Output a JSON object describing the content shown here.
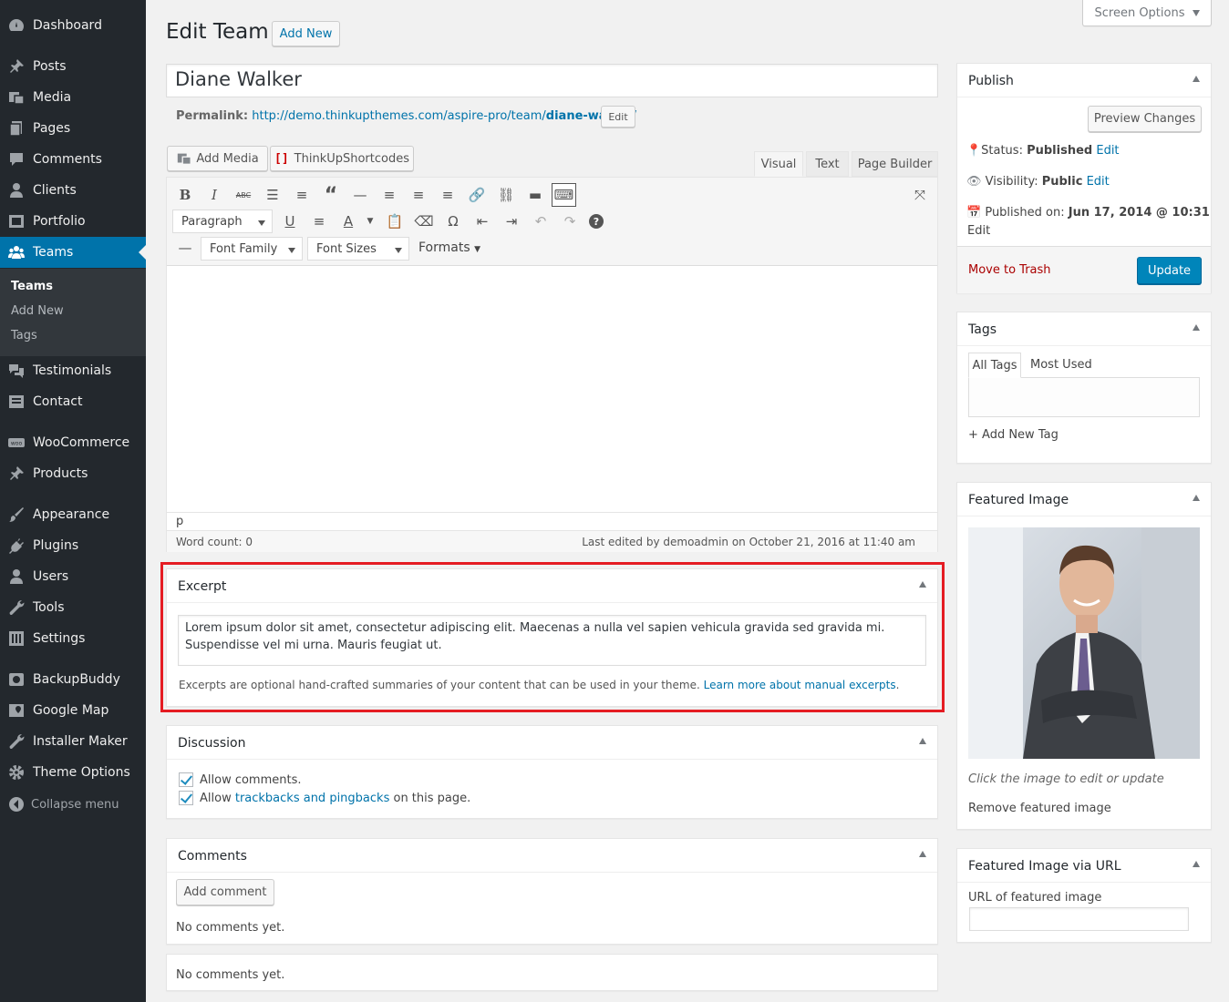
{
  "sidebar": {
    "items": [
      {
        "key": "dashboard",
        "label": "Dashboard",
        "icon": "dashboard-icon"
      },
      {
        "key": "posts",
        "label": "Posts",
        "icon": "pushpin-icon"
      },
      {
        "key": "media",
        "label": "Media",
        "icon": "media-icon"
      },
      {
        "key": "pages",
        "label": "Pages",
        "icon": "pages-icon"
      },
      {
        "key": "comments",
        "label": "Comments",
        "icon": "comment-icon"
      },
      {
        "key": "clients",
        "label": "Clients",
        "icon": "user-icon"
      },
      {
        "key": "portfolio",
        "label": "Portfolio",
        "icon": "portfolio-icon"
      },
      {
        "key": "teams",
        "label": "Teams",
        "icon": "groups-icon"
      },
      {
        "key": "testimonials",
        "label": "Testimonials",
        "icon": "testimonial-icon"
      },
      {
        "key": "contact",
        "label": "Contact",
        "icon": "contact-icon"
      },
      {
        "key": "woocommerce",
        "label": "WooCommerce",
        "icon": "woo-icon"
      },
      {
        "key": "products",
        "label": "Products",
        "icon": "pushpin-icon"
      },
      {
        "key": "appearance",
        "label": "Appearance",
        "icon": "brush-icon"
      },
      {
        "key": "plugins",
        "label": "Plugins",
        "icon": "plug-icon"
      },
      {
        "key": "users",
        "label": "Users",
        "icon": "user-icon"
      },
      {
        "key": "tools",
        "label": "Tools",
        "icon": "wrench-icon"
      },
      {
        "key": "settings",
        "label": "Settings",
        "icon": "settings-icon"
      },
      {
        "key": "backupbuddy",
        "label": "BackupBuddy",
        "icon": "backup-icon"
      },
      {
        "key": "googlemap",
        "label": "Google Map",
        "icon": "map-icon"
      },
      {
        "key": "installer",
        "label": "Installer Maker",
        "icon": "wrench-icon"
      },
      {
        "key": "themeoptions",
        "label": "Theme Options",
        "icon": "gear-icon"
      }
    ],
    "submenu": [
      "Teams",
      "Add New",
      "Tags"
    ],
    "collapse": "Collapse menu"
  },
  "header": {
    "title": "Edit Team",
    "add_new": "Add New",
    "screen_options": "Screen Options"
  },
  "post": {
    "title": "Diane Walker",
    "permalink_label": "Permalink:",
    "permalink_base": "http://demo.thinkupthemes.com/aspire-pro/team/",
    "permalink_slug": "diane-walker",
    "permalink_end": "/",
    "edit": "Edit"
  },
  "editor": {
    "add_media": "Add Media",
    "shortcodes": "ThinkUpShortcodes",
    "tabs": [
      "Visual",
      "Text",
      "Page Builder"
    ],
    "paragraph": "Paragraph",
    "font_family": "Font Family",
    "font_sizes": "Font Sizes",
    "formats": "Formats",
    "path": "p",
    "word_count": "Word count: 0",
    "last_edited": "Last edited by demoadmin on October 21, 2016 at 11:40 am"
  },
  "excerpt": {
    "title": "Excerpt",
    "text": "Lorem ipsum dolor sit amet, consectetur adipiscing elit. Maecenas a nulla vel sapien vehicula gravida sed gravida mi. Suspendisse vel mi urna. Mauris feugiat ut.",
    "help": "Excerpts are optional hand-crafted summaries of your content that can be used in your theme.",
    "help_link": "Learn more about manual excerpts",
    "help_end": "."
  },
  "discussion": {
    "title": "Discussion",
    "allow_comments": "Allow comments.",
    "allow_prefix": "Allow",
    "allow_link": "trackbacks and pingbacks",
    "allow_suffix": "on this page."
  },
  "comments": {
    "title": "Comments",
    "add": "Add comment",
    "none": "No comments yet."
  },
  "extra": {
    "none": "No comments yet."
  },
  "publish": {
    "title": "Publish",
    "preview": "Preview Changes",
    "status_label": "Status:",
    "status": "Published",
    "visibility_label": "Visibility:",
    "visibility": "Public",
    "published_on_label": "Published on:",
    "published_on": "Jun 17, 2014 @ 10:31",
    "edit": "Edit",
    "trash": "Move to Trash",
    "update": "Update"
  },
  "tags": {
    "title": "Tags",
    "tab_all": "All Tags",
    "tab_most": "Most Used",
    "add": "+ Add New Tag"
  },
  "featured": {
    "title": "Featured Image",
    "caption": "Click the image to edit or update",
    "remove": "Remove featured image"
  },
  "featured_url": {
    "title": "Featured Image via URL",
    "label": "URL of featured image",
    "value": ""
  },
  "colors": {
    "accent": "#0073aa",
    "sidebar": "#23282d",
    "highlight": "#e51c23",
    "primary": "#0085ba"
  }
}
